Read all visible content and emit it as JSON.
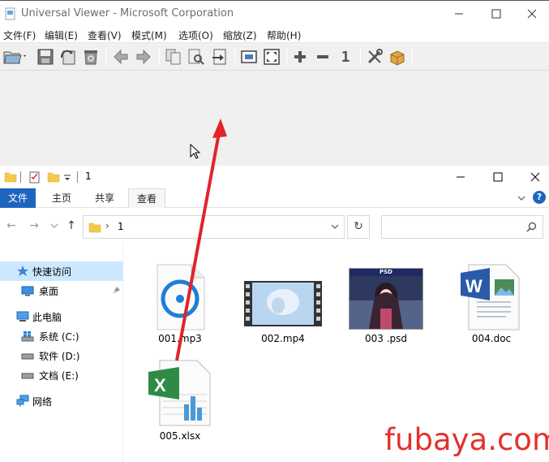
{
  "viewer": {
    "title": "Universal Viewer - Microsoft Corporation",
    "menu": [
      "文件(F)",
      "编辑(E)",
      "查看(V)",
      "模式(M)",
      "选项(O)",
      "缩放(Z)",
      "帮助(H)"
    ],
    "toolbar": {
      "icons": [
        "open-icon",
        "save-icon",
        "reload-icon",
        "delete-icon",
        "back-icon",
        "forward-icon",
        "copy-icon",
        "preview-icon",
        "export-icon",
        "fit-window-icon",
        "fullscreen-icon",
        "zoom-in-icon",
        "zoom-out-icon",
        "actual-size-icon",
        "tools-icon",
        "plugins-icon"
      ],
      "actual_size_label": "1"
    }
  },
  "explorer": {
    "title": "1",
    "ribbon_tabs": [
      "文件",
      "主页",
      "共享",
      "查看"
    ],
    "address": {
      "path": "1",
      "chevron": "›"
    },
    "navigation": {
      "quick_access": "快速访问",
      "desktop": "桌面",
      "this_pc": "此电脑",
      "drives": [
        "系统 (C:)",
        "软件 (D:)",
        "文档 (E:)"
      ],
      "network": "网络"
    },
    "files": [
      {
        "name": "001.mp3",
        "type": "audio"
      },
      {
        "name": "002.mp4",
        "type": "video"
      },
      {
        "name": "003 .psd",
        "type": "psd",
        "badge": "PSD"
      },
      {
        "name": "004.doc",
        "type": "word"
      },
      {
        "name": "005.xlsx",
        "type": "excel"
      }
    ],
    "help_label": "?"
  },
  "watermark": "fubaya.com",
  "colors": {
    "accent": "#1e65c0",
    "selection": "#cce8ff",
    "annotation": "#e3322b"
  }
}
